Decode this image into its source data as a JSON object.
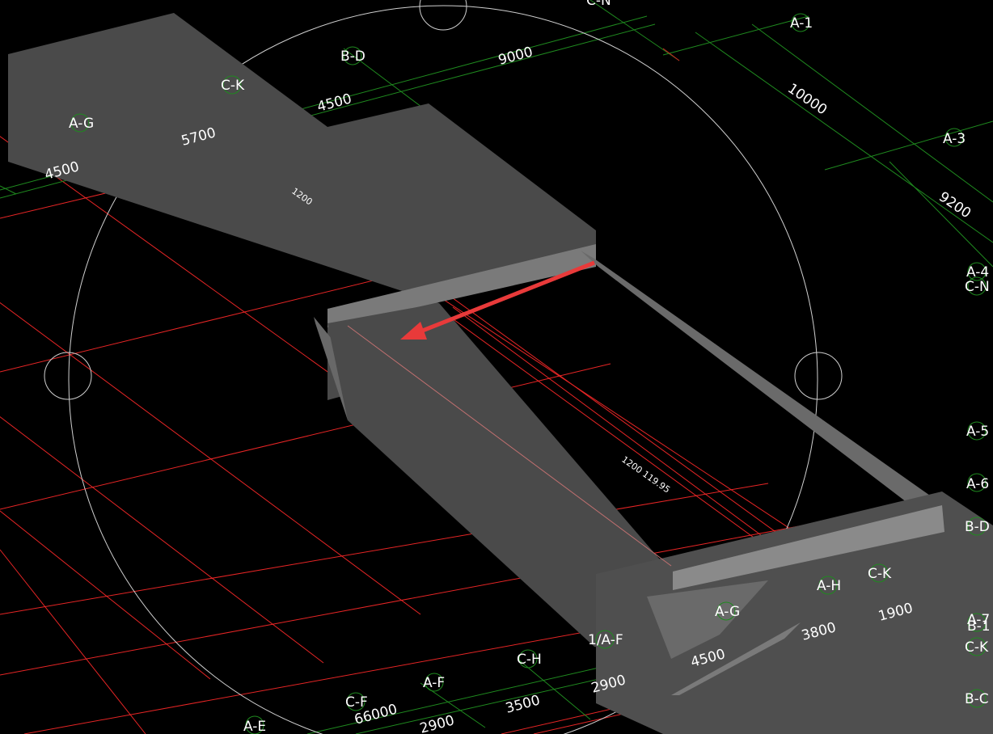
{
  "scene": {
    "background": "#000000",
    "grid_color": "#ff2a2a",
    "axis_color": "#1f8a1f",
    "solid_fill": "#5a5a5a",
    "highlight_fill": "#8a8a8a",
    "compass_stroke": "#d0d0d0",
    "arrow_color": "#e83a3a"
  },
  "axis_labels": {
    "a1": "A-1",
    "a3": "A-3",
    "a4": "A-4",
    "cn_right": "C-N",
    "cn_top": "C-N",
    "a5": "A-5",
    "a6": "A-6",
    "bd_right": "B-D",
    "a7": "A-7",
    "b1": "B-1",
    "ck_right": "C-K",
    "bc_right": "B-C",
    "bd_top": "B-D",
    "ck_top": "C-K",
    "ag_top": "A-G",
    "ck_bottom": "C-K",
    "ah_bottom": "A-H",
    "ag_bottom": "A-G",
    "af1_bottom": "1/A-F",
    "ch_bottom": "C-H",
    "af_bottom": "A-F",
    "cf_bottom": "C-F",
    "ae_bottom": "A-E"
  },
  "dimensions": {
    "d9000": "9000",
    "d4500_top": "4500",
    "d5700": "5700",
    "d4500_left": "4500",
    "d10000": "10000",
    "d9200": "9200",
    "d1900": "1900",
    "d3800": "3800",
    "d4500_bottom": "4500",
    "d2900_a": "2900",
    "d3500": "3500",
    "d2900_b": "2900",
    "d66000": "66000"
  },
  "annotations": {
    "beam_small": "1200",
    "beam_section": "1200 119.95"
  }
}
